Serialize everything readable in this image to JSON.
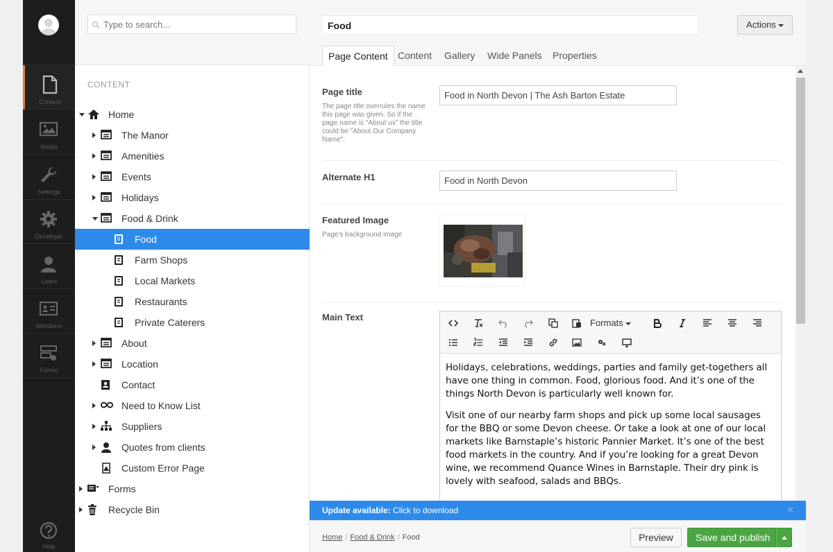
{
  "sections": [
    {
      "label": "Content",
      "icon": "document-icon"
    },
    {
      "label": "Media",
      "icon": "image-icon"
    },
    {
      "label": "Settings",
      "icon": "wrench-icon"
    },
    {
      "label": "Developer",
      "icon": "gear-icon"
    },
    {
      "label": "Users",
      "icon": "user-icon"
    },
    {
      "label": "Members",
      "icon": "id-card-icon"
    },
    {
      "label": "Forms",
      "icon": "forms-icon"
    }
  ],
  "help": {
    "label": "Help"
  },
  "colors": {
    "accent": "#e8773c",
    "selected": "#2e8aea",
    "publish": "#4aa543"
  },
  "search": {
    "placeholder": "Type to search..."
  },
  "tree": {
    "title": "CONTENT",
    "nodes": [
      {
        "label": "Home"
      },
      {
        "label": "The Manor"
      },
      {
        "label": "Amenities"
      },
      {
        "label": "Events"
      },
      {
        "label": "Holidays"
      },
      {
        "label": "Food & Drink"
      },
      {
        "label": "Food"
      },
      {
        "label": "Farm Shops"
      },
      {
        "label": "Local Markets"
      },
      {
        "label": "Restaurants"
      },
      {
        "label": "Private Caterers"
      },
      {
        "label": "About"
      },
      {
        "label": "Location"
      },
      {
        "label": "Contact"
      },
      {
        "label": "Need to Know List"
      },
      {
        "label": "Suppliers"
      },
      {
        "label": "Quotes from clients"
      },
      {
        "label": "Custom Error Page"
      },
      {
        "label": "Forms"
      },
      {
        "label": "Recycle Bin"
      }
    ]
  },
  "editor": {
    "name": "Food",
    "actions_label": "Actions",
    "tabs": [
      "Page Content",
      "Content",
      "Gallery",
      "Wide Panels",
      "Properties"
    ],
    "props": {
      "page_title": {
        "label": "Page title",
        "description": "The page title overrules the name this page was given. So if the page name is \"About us\" the title could be \"About Our Company Name\".",
        "value": "Food in North Devon | The Ash Barton Estate"
      },
      "alternate_h1": {
        "label": "Alternate H1",
        "value": "Food in North Devon"
      },
      "featured_image": {
        "label": "Featured Image",
        "description": "Page's background image"
      },
      "main_text": {
        "label": "Main Text",
        "formats_label": "Formats",
        "paragraphs": [
          "Holidays, celebrations, weddings, parties and family get-togethers all have one thing in common. Food, glorious food. And it’s one of the things North Devon is particularly well known for.",
          "Visit one of our nearby farm shops and pick up some local sausages for the BBQ or some Devon cheese. Or take a look at one of our local markets like Barnstaple’s historic Pannier Market. It’s one of the best food markets in the country. And if you’re looking for a great Devon wine, we recommend Quance Wines in Barnstaple. Their dry pink is lovely with seafood, salads and BBQs."
        ]
      }
    }
  },
  "update": {
    "bold": "Update available:",
    "text": " Click to download",
    "close": "×"
  },
  "breadcrumb": [
    "Home",
    "Food & Drink",
    "Food"
  ],
  "footer": {
    "preview": "Preview",
    "publish": "Save and publish"
  }
}
